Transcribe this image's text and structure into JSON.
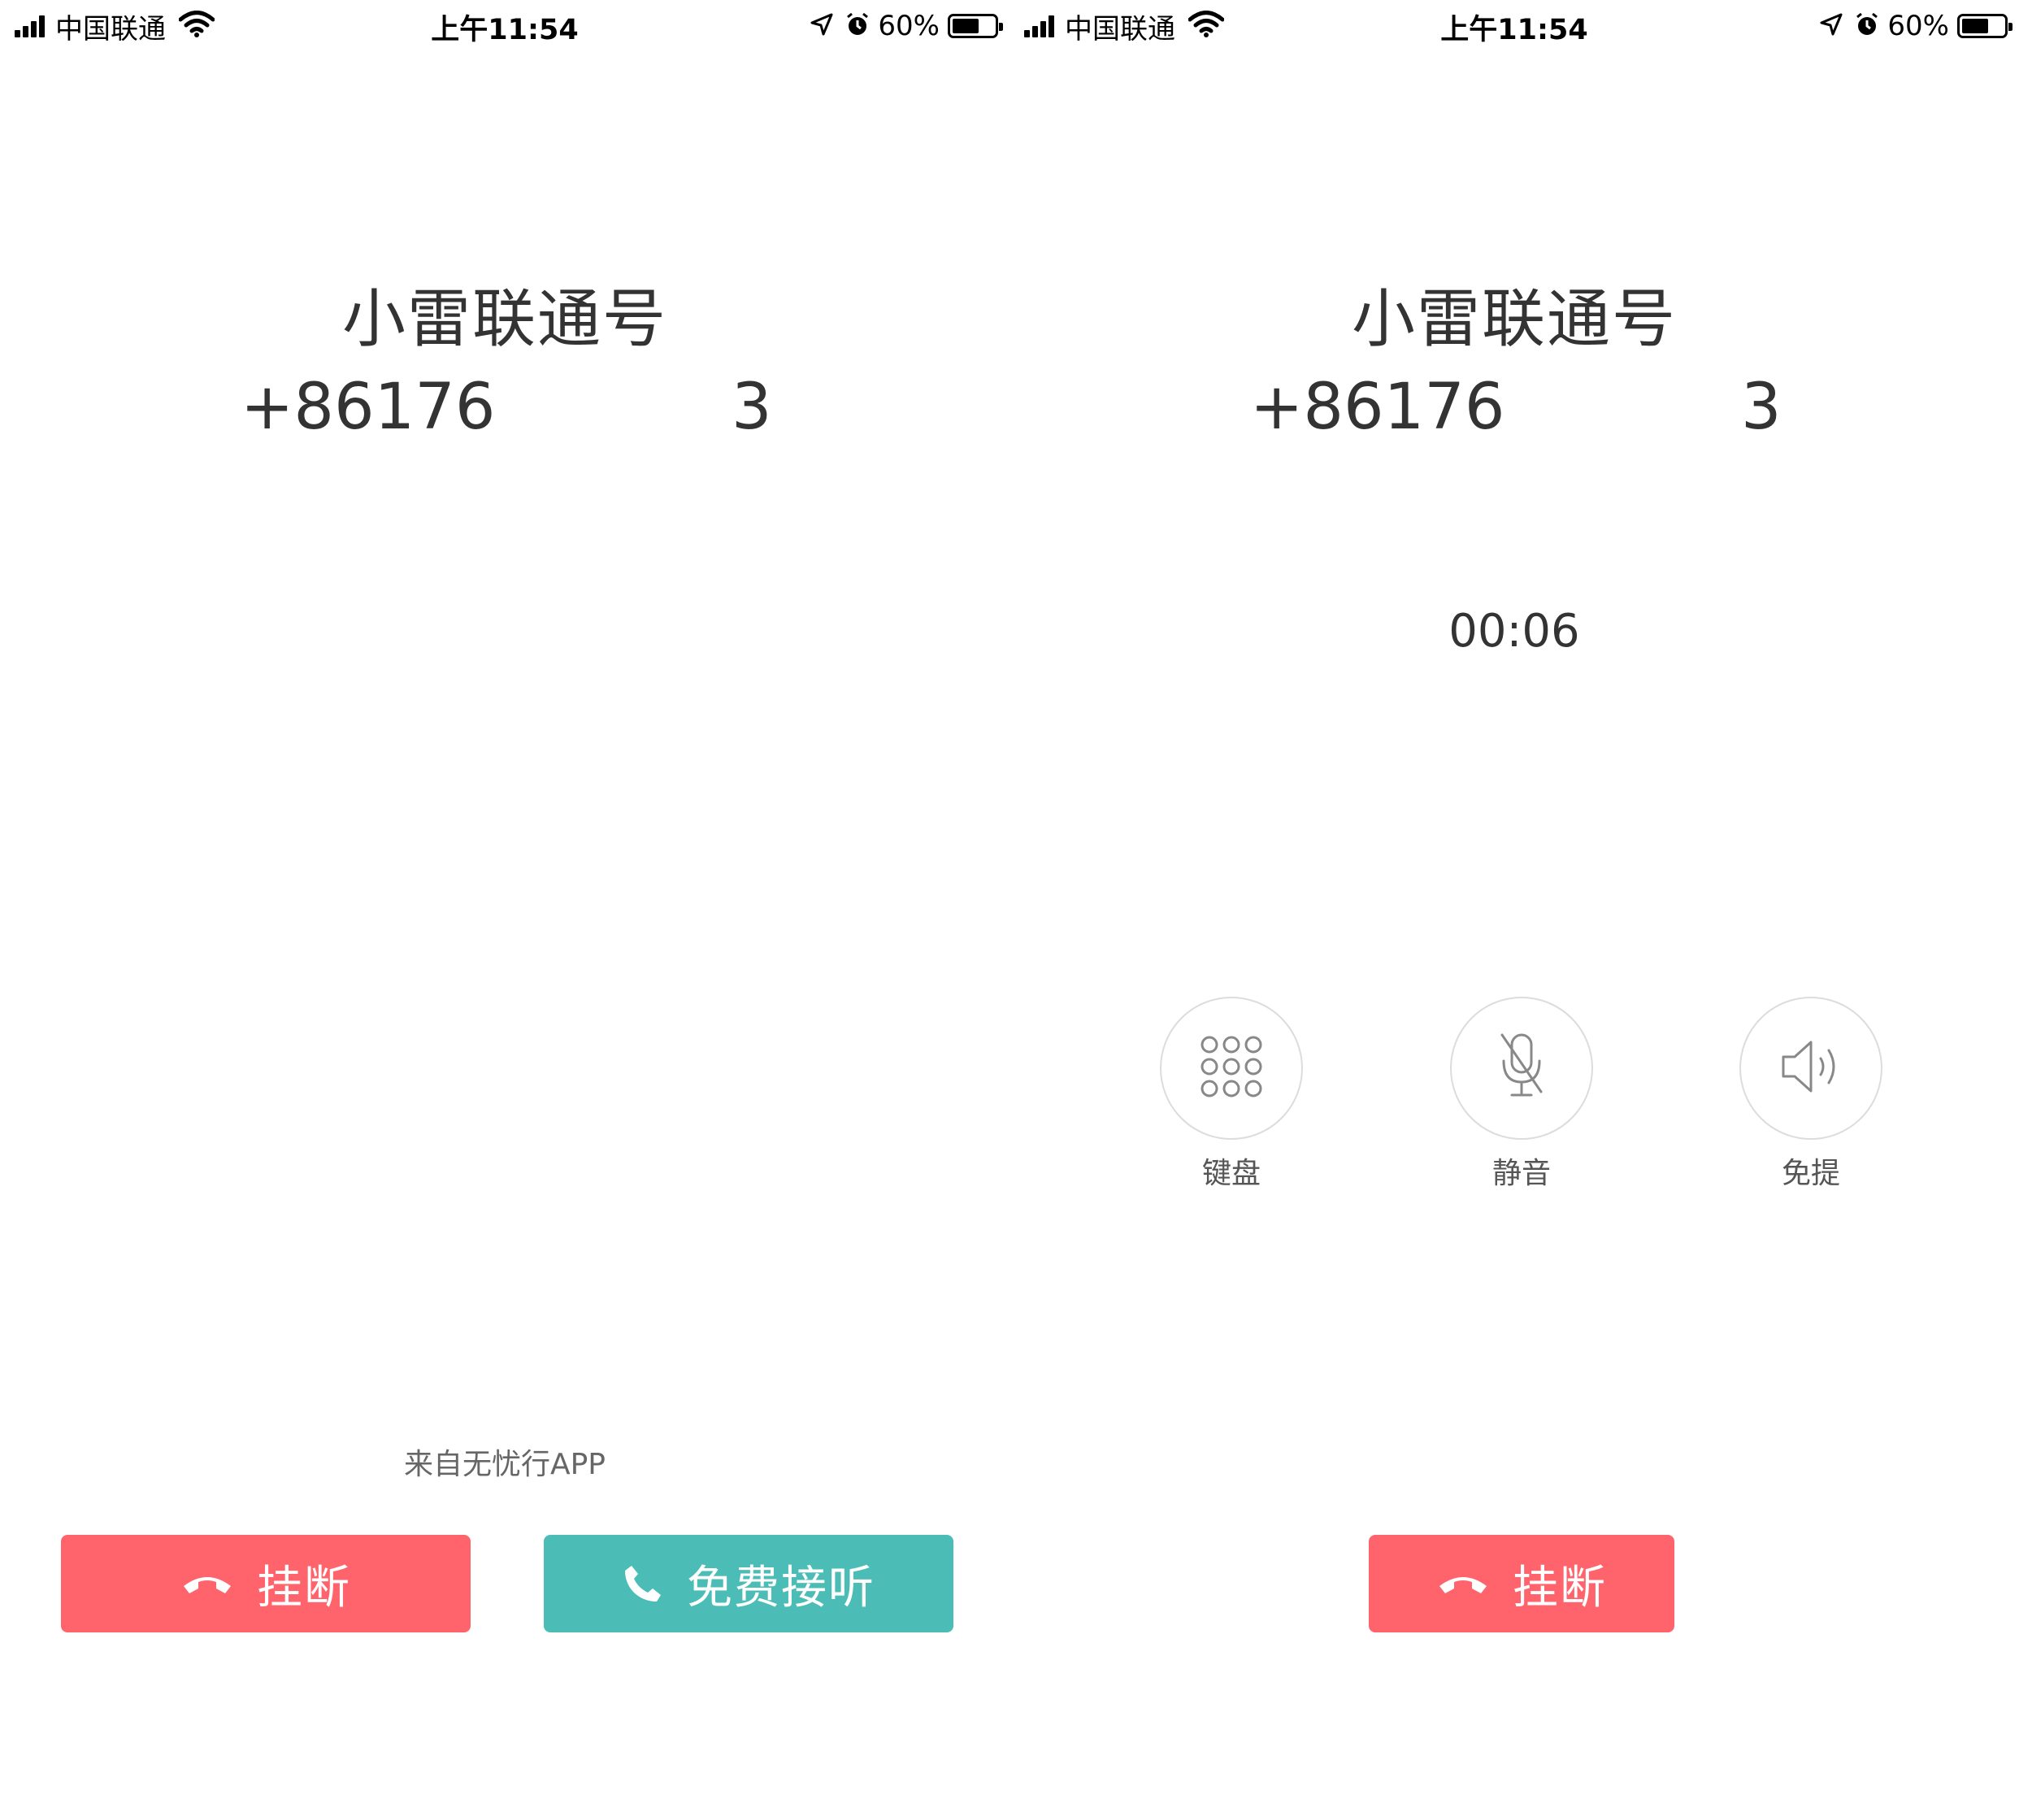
{
  "screens": [
    {
      "status_bar": {
        "carrier": "中国联通",
        "time": "上午11:54",
        "battery_pct": "60%",
        "battery_level": 0.6
      },
      "caller": {
        "name": "小雷联通号",
        "number_prefix": "+86176",
        "number_suffix": "3"
      },
      "source_text": "来自无忧行APP",
      "buttons": {
        "hangup": "挂断",
        "answer": "免费接听"
      }
    },
    {
      "status_bar": {
        "carrier": "中国联通",
        "time": "上午11:54",
        "battery_pct": "60%",
        "battery_level": 0.6
      },
      "caller": {
        "name": "小雷联通号",
        "number_prefix": "+86176",
        "number_suffix": "3"
      },
      "timer": "00:06",
      "controls": {
        "keypad": "键盘",
        "mute": "静音",
        "speaker": "免提"
      },
      "buttons": {
        "hangup": "挂断"
      }
    }
  ],
  "colors": {
    "hangup": "#ff636c",
    "answer": "#4bbdb6",
    "icon_gray": "#888888"
  },
  "icons": [
    "signal-icon",
    "wifi-icon",
    "location-icon",
    "alarm-icon",
    "battery-icon",
    "hangup-phone-icon",
    "phone-icon",
    "keypad-icon",
    "mute-mic-icon",
    "speaker-icon"
  ]
}
